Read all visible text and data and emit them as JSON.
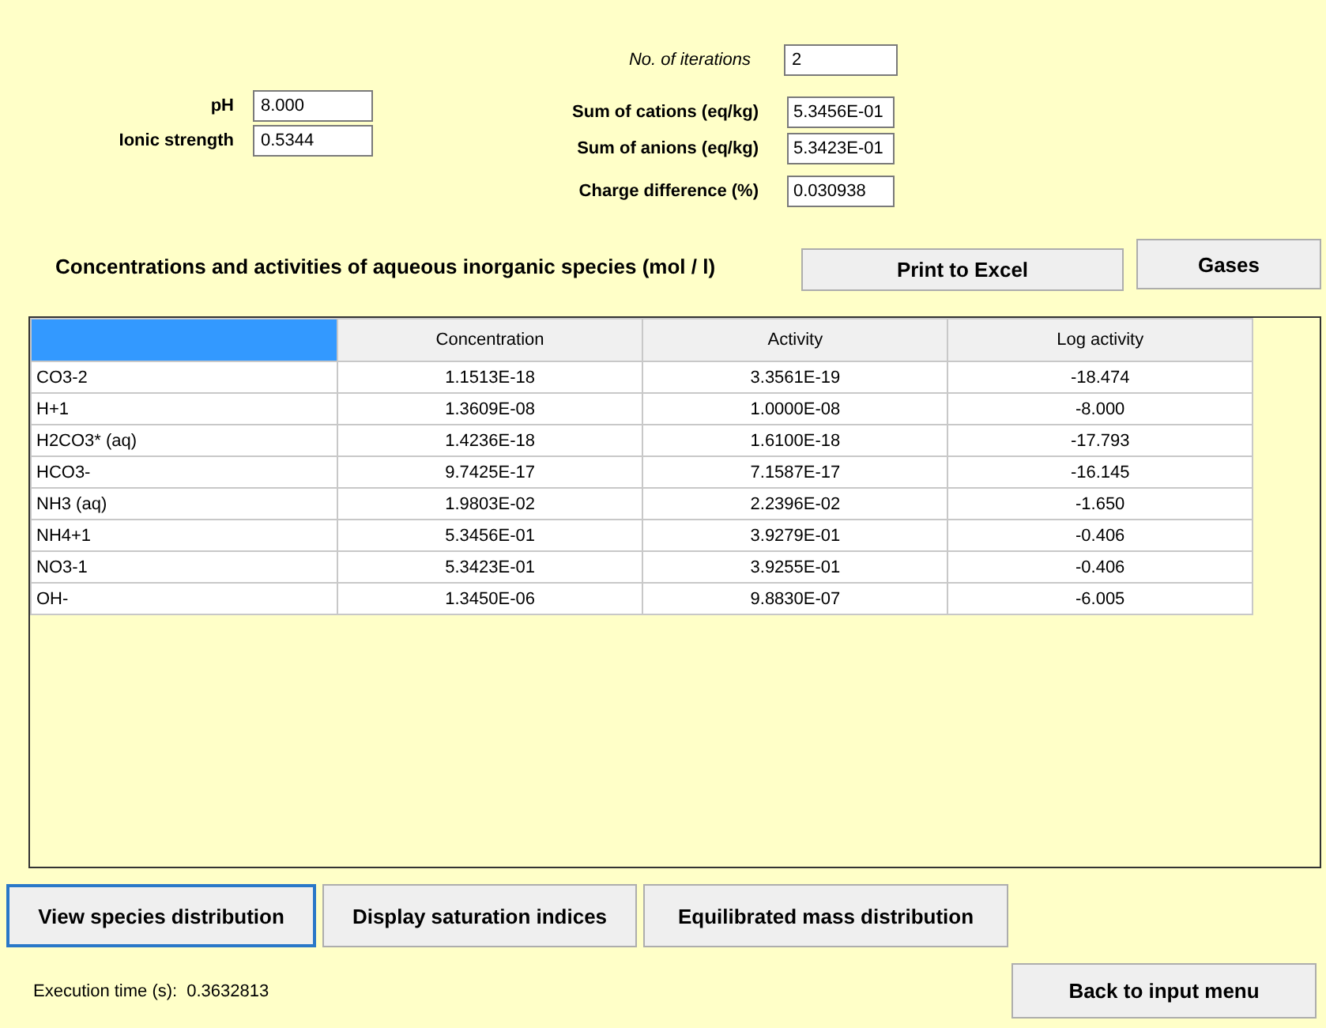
{
  "iterations": {
    "label": "No. of iterations",
    "value": "2"
  },
  "left_fields": [
    {
      "label": "pH",
      "value": "8.000"
    },
    {
      "label": "Ionic strength",
      "value": "0.5344"
    }
  ],
  "right_fields": [
    {
      "label": "Sum of cations (eq/kg)",
      "value": "5.3456E-01"
    },
    {
      "label": "Sum of anions (eq/kg)",
      "value": "5.3423E-01"
    },
    {
      "label": "Charge difference (%)",
      "value": "0.030938"
    }
  ],
  "section_title": "Concentrations and activities of aqueous inorganic species (mol / l)",
  "print_button": "Print to Excel",
  "gases_button": "Gases",
  "table": {
    "columns": [
      "",
      "Concentration",
      "Activity",
      "Log activity"
    ],
    "rows": [
      [
        "CO3-2",
        "1.1513E-18",
        "3.3561E-19",
        "-18.474"
      ],
      [
        "H+1",
        "1.3609E-08",
        "1.0000E-08",
        "-8.000"
      ],
      [
        "H2CO3* (aq)",
        "1.4236E-18",
        "1.6100E-18",
        "-17.793"
      ],
      [
        "HCO3-",
        "9.7425E-17",
        "7.1587E-17",
        "-16.145"
      ],
      [
        "NH3 (aq)",
        "1.9803E-02",
        "2.2396E-02",
        "-1.650"
      ],
      [
        "NH4+1",
        "5.3456E-01",
        "3.9279E-01",
        "-0.406"
      ],
      [
        "NO3-1",
        "5.3423E-01",
        "3.9255E-01",
        "-0.406"
      ],
      [
        "OH-",
        "1.3450E-06",
        "9.8830E-07",
        "-6.005"
      ]
    ]
  },
  "view_tabs": [
    {
      "label": "View species distribution",
      "selected": true
    },
    {
      "label": "Display saturation indices",
      "selected": false
    },
    {
      "label": "Equilibrated mass distribution",
      "selected": false
    }
  ],
  "execution_time": {
    "label": "Execution time (s):",
    "value": "0.3632813"
  },
  "back_button": "Back to input menu"
}
